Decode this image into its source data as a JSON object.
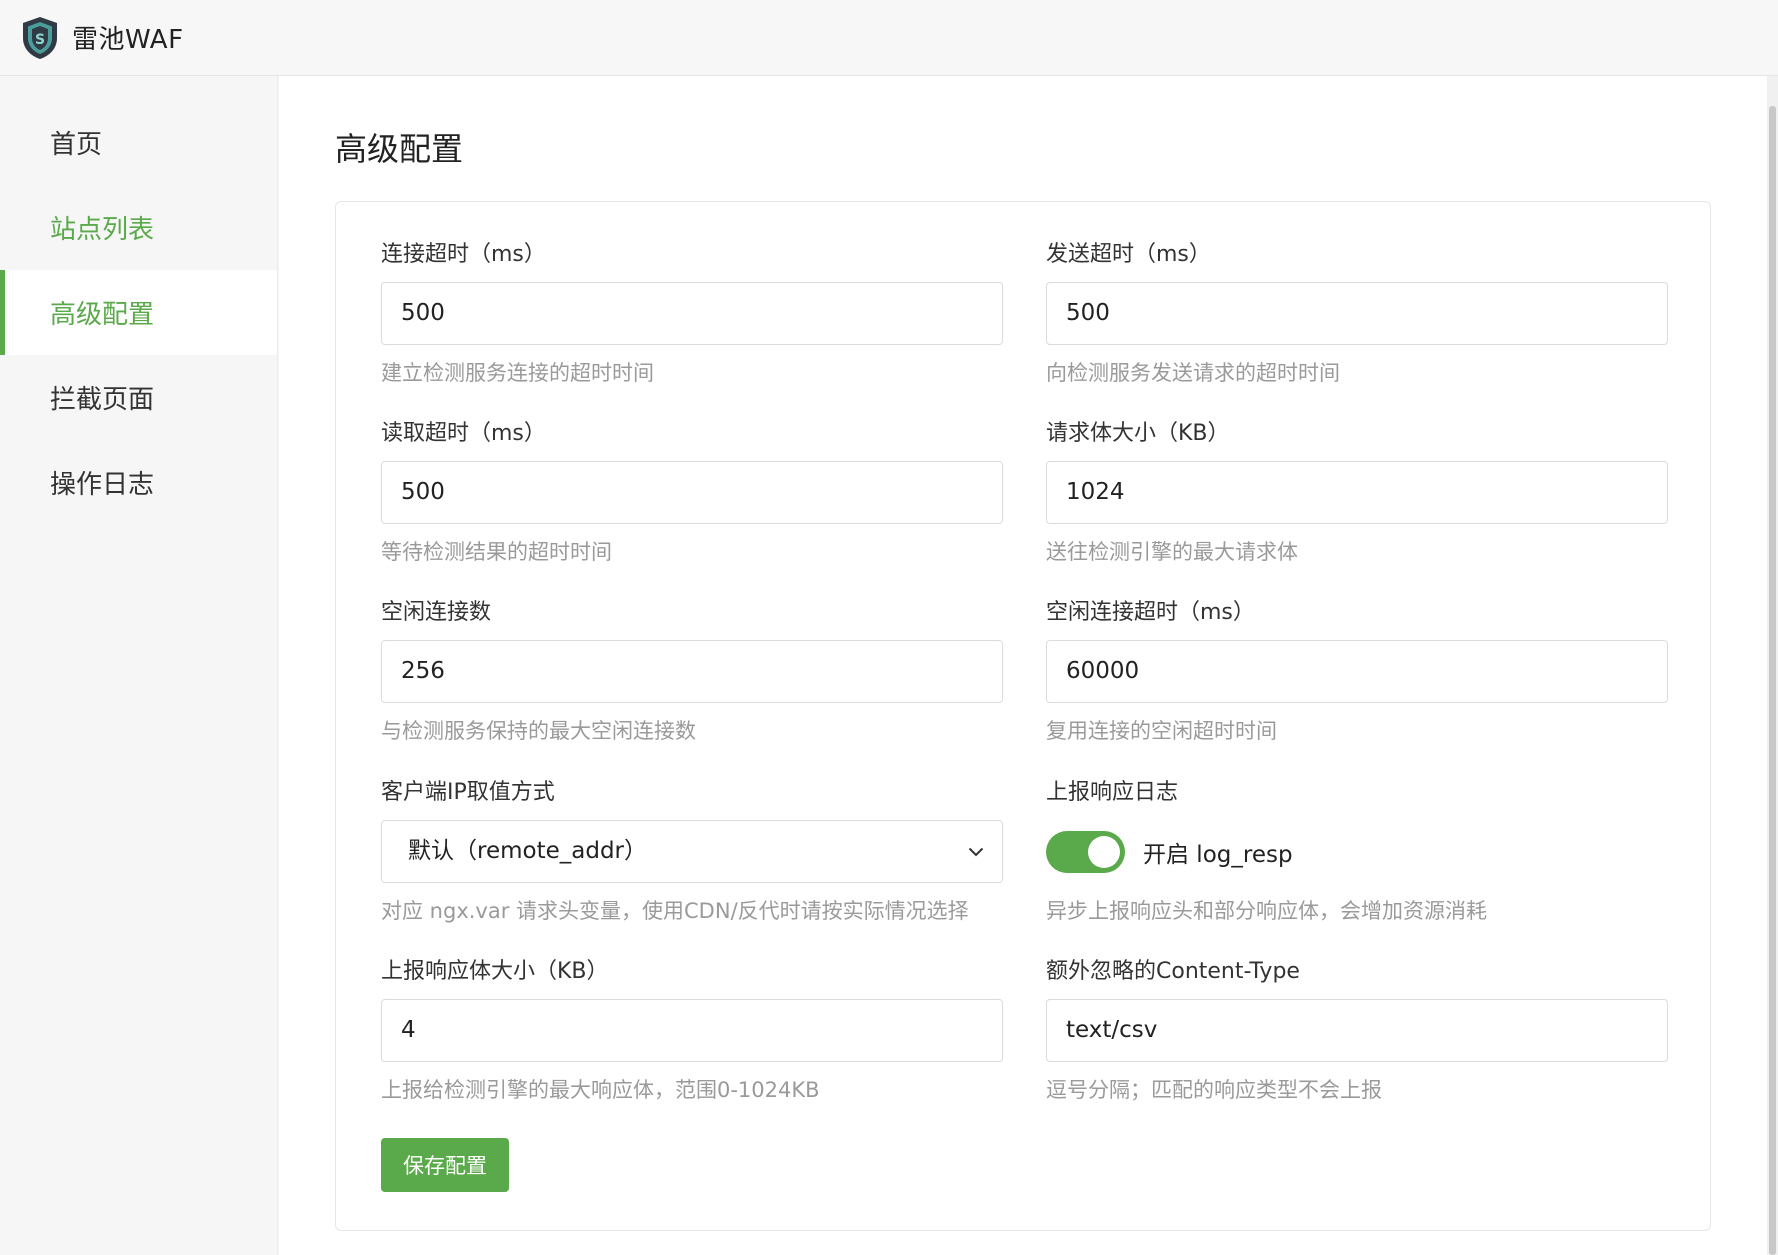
{
  "app": {
    "title": "雷池WAF",
    "logo_icon": "shield-logo-icon"
  },
  "colors": {
    "accent": "#5aa94a",
    "hint": "#9a9a9a"
  },
  "sidebar": {
    "items": [
      {
        "label": "首页",
        "state": "normal"
      },
      {
        "label": "站点列表",
        "state": "link"
      },
      {
        "label": "高级配置",
        "state": "active"
      },
      {
        "label": "拦截页面",
        "state": "normal"
      },
      {
        "label": "操作日志",
        "state": "normal"
      }
    ]
  },
  "page": {
    "title": "高级配置"
  },
  "form": {
    "connect_timeout": {
      "label": "连接超时（ms）",
      "value": "500",
      "hint": "建立检测服务连接的超时时间"
    },
    "send_timeout": {
      "label": "发送超时（ms）",
      "value": "500",
      "hint": "向检测服务发送请求的超时时间"
    },
    "read_timeout": {
      "label": "读取超时（ms）",
      "value": "500",
      "hint": "等待检测结果的超时时间"
    },
    "body_size": {
      "label": "请求体大小（KB）",
      "value": "1024",
      "hint": "送往检测引擎的最大请求体"
    },
    "idle_conns": {
      "label": "空闲连接数",
      "value": "256",
      "hint": "与检测服务保持的最大空闲连接数"
    },
    "idle_timeout": {
      "label": "空闲连接超时（ms）",
      "value": "60000",
      "hint": "复用连接的空闲超时时间"
    },
    "client_ip": {
      "label": "客户端IP取值方式",
      "value": "默认（remote_addr）",
      "hint": "对应 ngx.var 请求头变量，使用CDN/反代时请按实际情况选择"
    },
    "log_resp": {
      "label": "上报响应日志",
      "toggle_label": "开启 log_resp",
      "enabled": true,
      "hint": "异步上报响应头和部分响应体，会增加资源消耗"
    },
    "resp_body_size": {
      "label": "上报响应体大小（KB）",
      "value": "4",
      "hint": "上报给检测引擎的最大响应体，范围0-1024KB"
    },
    "ignore_content_type": {
      "label": "额外忽略的Content-Type",
      "value": "text/csv",
      "hint": "逗号分隔；匹配的响应类型不会上报"
    },
    "save_label": "保存配置"
  }
}
